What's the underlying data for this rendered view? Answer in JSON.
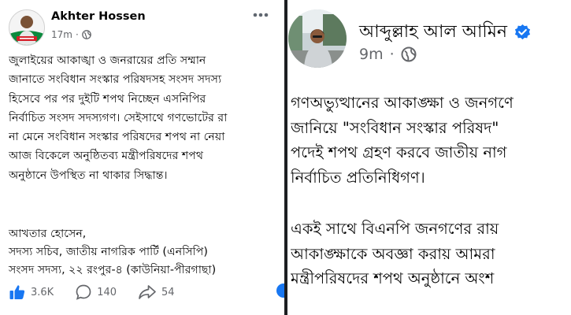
{
  "left_post": {
    "author": "Akhter Hossen",
    "time": "17m",
    "separator": "·",
    "body_lines": [
      "জুলাইয়ের আকাঙ্খা ও জনরায়ের প্রতি সম্মান",
      "জানাতে সংবিধান সংস্কার পরিষদসহ সংসদ সদস্য",
      "হিসেবে পর পর দুইটি শপথ নিচ্ছেন এসনিপির",
      "নির্বাচিত সংসদ সদস্যগণ। সেইসাথে গণভোটের রা",
      "না মেনে সংবিধান সংস্কার পরিষদের শপথ না নেয়া",
      "আজ বিকেলে অনুষ্ঠিতব্য মন্ত্রীপরিষদের শপথ",
      "অনুষ্ঠানে উপস্থিত না থাকার সিদ্ধান্ত।"
    ],
    "signature_lines": [
      "আখতার হোসেন,",
      "সদস্য সচিব, জাতীয় নাগরিক পার্টি (এনসিপি)",
      "সংসদ সদস্য, ২২ রংপুর-৪ (কাউনিয়া-পীরগাছা)"
    ],
    "likes": "3.6K",
    "comments": "140",
    "shares": "54",
    "icons": {
      "like": "like-thumb-icon",
      "comment": "comment-bubble-icon",
      "share": "share-arrow-icon",
      "audience": "globe-icon",
      "more": "more-horizontal-icon"
    },
    "colors": {
      "like_blue": "#1877f2",
      "avatar_green": "#0b8a3e",
      "avatar_red": "#d6202a"
    }
  },
  "right_post": {
    "author": "আব্দুল্লাহ আল আমিন",
    "time": "9m",
    "separator": "·",
    "body_lines": [
      "গণঅভ্যুত্থানের আকাঙ্ক্ষা ও জনগণে",
      "জানিয়ে \"সংবিধান সংস্কার পরিষদ\"",
      "পদেই শপথ গ্রহণ করবে জাতীয় নাগ",
      "নির্বাচিত প্রতিনিধিগণ।",
      "একই সাথে বিএনপি জনগণের রায়",
      "আকাঙ্ক্ষাকে অবজ্ঞা করায় আমরা",
      "মন্ত্রীপরিষদের শপথ অনুষ্ঠানে অংশ"
    ],
    "icons": {
      "verified": "verified-badge-icon",
      "audience": "globe-icon"
    },
    "colors": {
      "verified_blue": "#1877f2"
    }
  }
}
